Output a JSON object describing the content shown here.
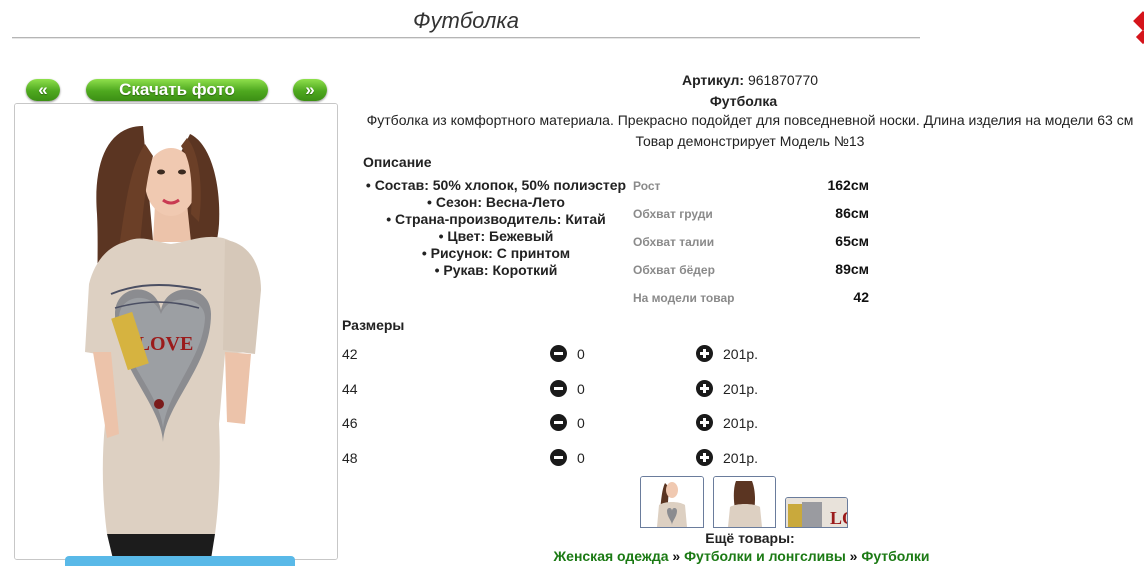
{
  "page": {
    "title": "Футболка"
  },
  "gallery": {
    "prev_label": "«",
    "download_label": "Скачать фото",
    "next_label": "»",
    "thumbnails": [
      "thumb-front",
      "thumb-back",
      "thumb-print-closeup"
    ]
  },
  "product": {
    "article_label": "Артикул:",
    "article_value": "961870770",
    "name": "Футболка",
    "description": "Футболка из комфортного материала. Прекрасно подойдет для повседневной носки. Длина изделия на модели 63 см",
    "model_note": "Товар демонстрирует Модель №13",
    "description_heading": "Описание",
    "features": [
      "Состав: 50% хлопок, 50% полиэстер",
      "Сезон: Весна-Лето",
      "Страна-производитель: Китай",
      "Цвет: Бежевый",
      "Рисунок: С принтом",
      "Рукав: Короткий"
    ]
  },
  "measurements": [
    {
      "label": "Рост",
      "value": "162см"
    },
    {
      "label": "Обхват груди",
      "value": "86см"
    },
    {
      "label": "Обхват талии",
      "value": "65см"
    },
    {
      "label": "Обхват бёдер",
      "value": "89см"
    },
    {
      "label": "На модели товар",
      "value": "42"
    }
  ],
  "sizes": {
    "heading": "Размеры",
    "rows": [
      {
        "size": "42",
        "qty": "0",
        "price": "201р."
      },
      {
        "size": "44",
        "qty": "0",
        "price": "201р."
      },
      {
        "size": "46",
        "qty": "0",
        "price": "201р."
      },
      {
        "size": "48",
        "qty": "0",
        "price": "201р."
      }
    ]
  },
  "more": {
    "heading": "Ещё товары:",
    "crumbs": [
      "Женская одежда",
      "Футболки и лонгсливы",
      "Футболки"
    ],
    "separator": " » "
  },
  "colors": {
    "button_green": "#4ea81f",
    "link_green": "#1b7a14",
    "shirt_beige": "#ddd0c2",
    "print_red": "#9b1b1b"
  }
}
